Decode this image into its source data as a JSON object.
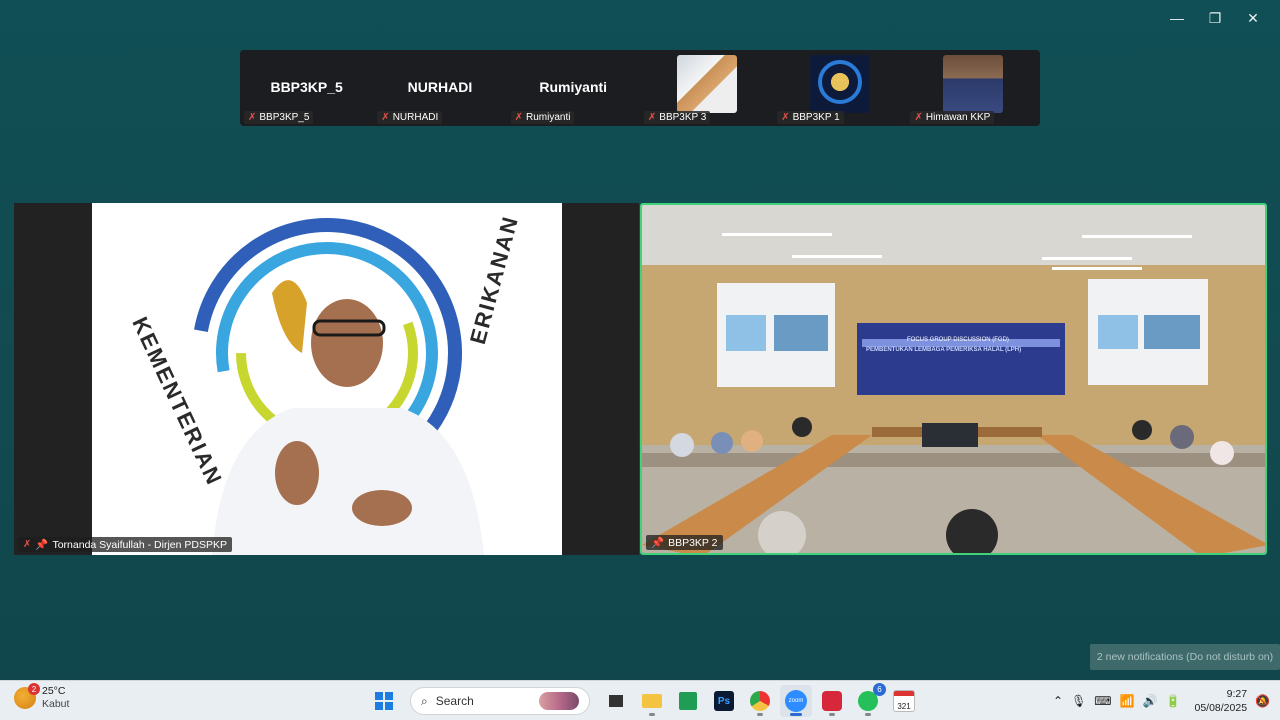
{
  "window": {
    "controls": [
      "minimize",
      "maximize",
      "close"
    ]
  },
  "participants": [
    {
      "display": "BBP3KP_5",
      "label": "BBP3KP_5",
      "muted": true
    },
    {
      "display": "NURHADI",
      "label": "NURHADI",
      "muted": true
    },
    {
      "display": "Rumiyanti",
      "label": "Rumiyanti",
      "muted": true
    },
    {
      "display": "",
      "label": "BBP3KP 3",
      "muted": true
    },
    {
      "display": "",
      "label": "BBP3KP 1",
      "muted": true
    },
    {
      "display": "",
      "label": "Himawan KKP",
      "muted": true
    }
  ],
  "main_videos": {
    "left_label": "Tornanda Syaifullah - Dirjen PDSPKP",
    "right_label": "BBP3KP 2",
    "slide_text": "KEMENTERIAN",
    "slide_text_right": "ERIKANAN",
    "room_banner_top": "FOCUS GROUP DISCUSSION (FGD)",
    "room_banner_main": "PEMBENTUKAN LEMBAGA PEMERIKSA HALAL (LPH)"
  },
  "toast": {
    "text": "2 new notifications (Do not disturb on)"
  },
  "taskbar": {
    "weather": {
      "temp": "25°C",
      "condition": "Kabut",
      "badge": "2"
    },
    "search_label": "Search",
    "apps": [
      {
        "name": "file-explorer"
      },
      {
        "name": "excel"
      },
      {
        "name": "photoshop",
        "text": "Ps"
      },
      {
        "name": "chrome"
      },
      {
        "name": "zoom",
        "text": "zoom"
      },
      {
        "name": "wps"
      },
      {
        "name": "whatsapp",
        "badge": "6"
      },
      {
        "name": "calendar",
        "text": "321"
      }
    ],
    "clock": {
      "time": "9:27",
      "date": "05/08/2025"
    }
  },
  "colors": {
    "active_speaker": "#3fd47a",
    "mute": "#e5534b",
    "bg": "#124a50"
  }
}
